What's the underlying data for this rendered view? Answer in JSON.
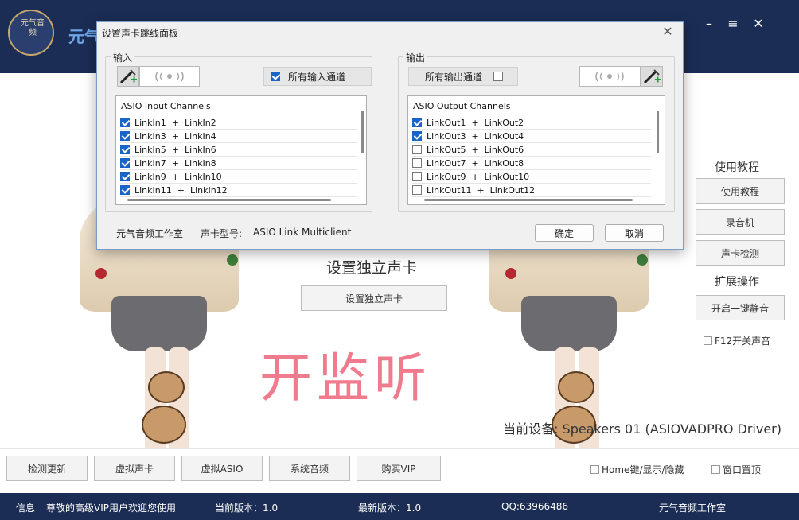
{
  "app": {
    "title": "元气",
    "logo_text": "元气音频",
    "minimize": "–",
    "menu": "≡",
    "close": "✕"
  },
  "main": {
    "section_title": "设置独立声卡",
    "set_card_button": "设置独立声卡",
    "big_text": "开监听",
    "current_device": "当前设备: Speakers 01 (ASIOVADPRO Driver)"
  },
  "side": {
    "tutorial_title": "使用教程",
    "buttons": [
      "使用教程",
      "录音机",
      "声卡检测"
    ],
    "ext_title": "扩展操作",
    "mute_button": "开启一键静音",
    "f12_label": "F12开关声音"
  },
  "bottom": {
    "buttons": [
      "检测更新",
      "虚拟声卡",
      "虚拟ASIO",
      "系统音频",
      "购买VIP"
    ],
    "home_key_label": "Home键/显示/隐藏",
    "topmost_label": "窗口置顶"
  },
  "status": {
    "info": "信息",
    "welcome": "尊敬的高级VIP用户欢迎您使用",
    "current_version": "当前版本：1.0",
    "latest_version": "最新版本：1.0",
    "qq": "QQ:63966486",
    "studio": "元气音频工作室"
  },
  "dialog": {
    "title": "设置声卡跳线面板",
    "close": "✕",
    "input_group": "输入",
    "output_group": "输出",
    "all_input_label": "所有输入通道",
    "all_input_checked": true,
    "all_output_label": "所有输出通道",
    "all_output_checked": false,
    "input_list_header": "ASIO Input Channels",
    "output_list_header": "ASIO Output Channels",
    "input_channels": [
      {
        "label": "LinkIn1  +  LinkIn2",
        "checked": true
      },
      {
        "label": "LinkIn3  +  LinkIn4",
        "checked": true
      },
      {
        "label": "LinkIn5  +  LinkIn6",
        "checked": true
      },
      {
        "label": "LinkIn7  +  LinkIn8",
        "checked": true
      },
      {
        "label": "LinkIn9  +  LinkIn10",
        "checked": true
      },
      {
        "label": "LinkIn11  +  LinkIn12",
        "checked": true
      }
    ],
    "output_channels": [
      {
        "label": "LinkOut1  +  LinkOut2",
        "checked": true
      },
      {
        "label": "LinkOut3  +  LinkOut4",
        "checked": true
      },
      {
        "label": "LinkOut5  +  LinkOut6",
        "checked": false
      },
      {
        "label": "LinkOut7  +  LinkOut8",
        "checked": false
      },
      {
        "label": "LinkOut9  +  LinkOut10",
        "checked": false
      },
      {
        "label": "LinkOut11  +  LinkOut12",
        "checked": false
      }
    ],
    "studio_label": "元气音频工作室",
    "card_model_label": "声卡型号:",
    "card_model_value": "ASIO Link Multiclient",
    "ok_button": "确定",
    "cancel_button": "取消"
  },
  "colors": {
    "header_bg": "#1b2d55",
    "accent_blue": "#1a64c8",
    "listen_pink": "#f07b8d"
  }
}
